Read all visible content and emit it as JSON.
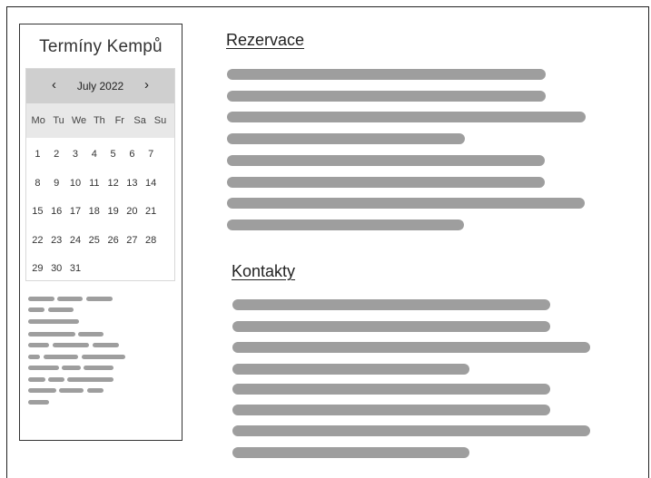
{
  "sidebar": {
    "title": "Termíny Kempů",
    "calendar": {
      "month_label": "July 2022",
      "prev_icon": "chevron-left-icon",
      "next_icon": "chevron-right-icon",
      "prev_glyph": "‹",
      "next_glyph": "›",
      "weekdays": [
        "Mo",
        "Tu",
        "We",
        "Th",
        "Fr",
        "Sa",
        "Su"
      ],
      "weeks": [
        [
          "1",
          "2",
          "3",
          "4",
          "5",
          "6",
          "7"
        ],
        [
          "8",
          "9",
          "10",
          "11",
          "12",
          "13",
          "14"
        ],
        [
          "15",
          "16",
          "17",
          "18",
          "19",
          "20",
          "21"
        ],
        [
          "22",
          "23",
          "24",
          "25",
          "26",
          "27",
          "28"
        ],
        [
          "29",
          "30",
          "31"
        ]
      ]
    }
  },
  "main": {
    "sections": [
      {
        "title": "Rezervace"
      },
      {
        "title": "Kontakty"
      }
    ]
  }
}
